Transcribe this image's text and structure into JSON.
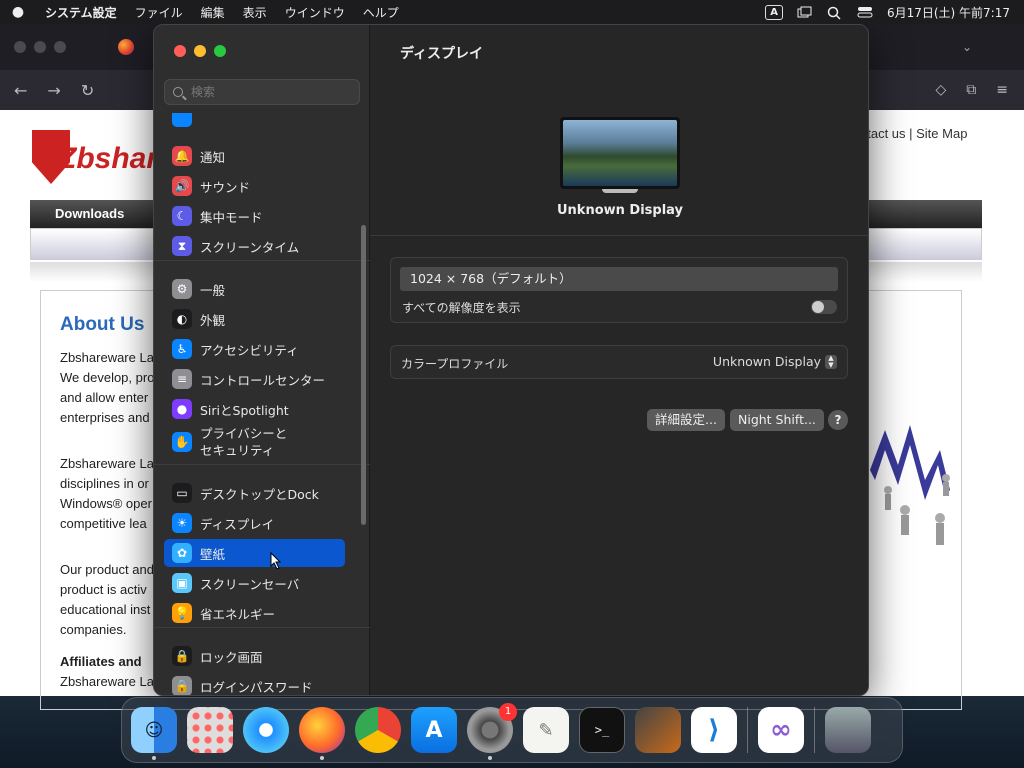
{
  "menubar": {
    "app_name": "システム設定",
    "items": [
      "ファイル",
      "編集",
      "表示",
      "ウインドウ",
      "ヘルプ"
    ],
    "input_indicator": "A",
    "clock": "6月17日(土) 午前7:17"
  },
  "browser": {
    "logo_text": "Zbshare",
    "top_links": "ntact us | Site Map",
    "nav_downloads": "Downloads",
    "about_heading": "About Us",
    "paragraph1": "Zbshareware La\nWe develop, pro\nand allow enter\nenterprises and",
    "paragraph2": "Zbshareware La\ndisciplines in or\nWindows® oper\ncompetitive lea",
    "paragraph3": "Our product and\nproduct is activ\neducational inst\ncompanies.",
    "affiliates": "Affiliates and",
    "last_line": "Zbshareware La"
  },
  "settings": {
    "search_placeholder": "検索",
    "sidebar": [
      {
        "label": "通知",
        "icon": "bell-icon",
        "color": "#e5484d"
      },
      {
        "label": "サウンド",
        "icon": "speaker-icon",
        "color": "#e5484d"
      },
      {
        "label": "集中モード",
        "icon": "moon-icon",
        "color": "#5e5ce6"
      },
      {
        "label": "スクリーンタイム",
        "icon": "hourglass-icon",
        "color": "#5e5ce6"
      },
      {
        "label": "一般",
        "icon": "gear-icon",
        "color": "#8e8e93"
      },
      {
        "label": "外観",
        "icon": "appearance-icon",
        "color": "#1c1c1e"
      },
      {
        "label": "アクセシビリティ",
        "icon": "accessibility-icon",
        "color": "#0a84ff"
      },
      {
        "label": "コントロールセンター",
        "icon": "toggles-icon",
        "color": "#8e8e93"
      },
      {
        "label": "SiriとSpotlight",
        "icon": "siri-icon",
        "color": "#7d3cff"
      },
      {
        "label": "プライバシーと\nセキュリティ",
        "icon": "hand-icon",
        "color": "#0a84ff"
      },
      {
        "label": "デスクトップとDock",
        "icon": "dock-icon",
        "color": "#1c1c1e"
      },
      {
        "label": "ディスプレイ",
        "icon": "sun-icon",
        "color": "#0a84ff"
      },
      {
        "label": "壁紙",
        "icon": "flower-icon",
        "color": "#30b0ff"
      },
      {
        "label": "スクリーンセーバ",
        "icon": "screensaver-icon",
        "color": "#5ac8fa"
      },
      {
        "label": "省エネルギー",
        "icon": "bulb-icon",
        "color": "#ff9f0a"
      },
      {
        "label": "ロック画面",
        "icon": "lock-icon",
        "color": "#1c1c1e"
      },
      {
        "label": "ログインパスワード",
        "icon": "lock-icon",
        "color": "#8e8e93"
      }
    ],
    "selected_index": 12,
    "main": {
      "title": "ディスプレイ",
      "display_name": "Unknown Display",
      "resolution": "1024 × 768（デフォルト）",
      "show_all_label": "すべての解像度を表示",
      "show_all_on": false,
      "color_profile_label": "カラープロファイル",
      "color_profile_value": "Unknown Display",
      "advanced_button": "詳細設定...",
      "night_shift_button": "Night Shift...",
      "help_button": "?"
    }
  },
  "dock": {
    "apps": [
      {
        "name": "finder-icon"
      },
      {
        "name": "launchpad-icon"
      },
      {
        "name": "safari-icon"
      },
      {
        "name": "firefox-icon"
      },
      {
        "name": "chrome-icon"
      },
      {
        "name": "app-store-icon"
      },
      {
        "name": "system-settings-icon",
        "badge": "1"
      },
      {
        "name": "textedit-icon"
      },
      {
        "name": "terminal-icon"
      },
      {
        "name": "garageband-icon"
      },
      {
        "name": "vscode-icon"
      },
      {
        "name": "visual-studio-icon"
      },
      {
        "name": "trash-icon"
      }
    ]
  }
}
